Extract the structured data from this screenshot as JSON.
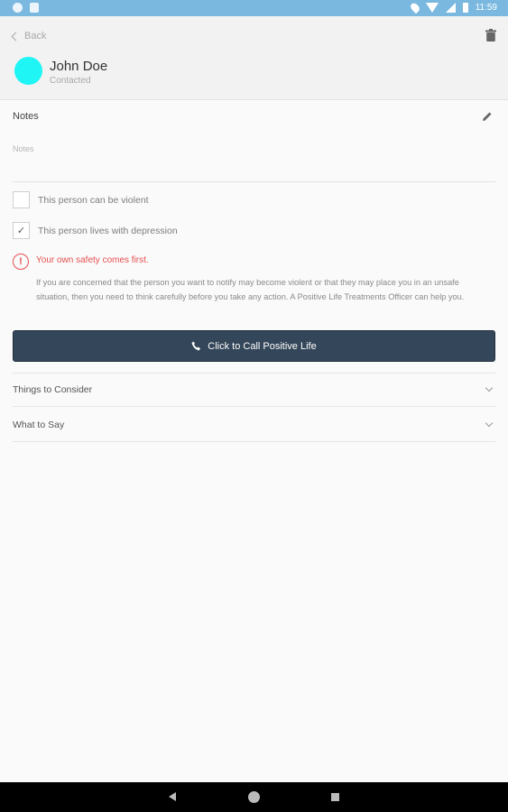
{
  "status_bar": {
    "time": "11:59"
  },
  "header": {
    "back_label": "Back",
    "contact_name": "John Doe",
    "contact_status": "Contacted",
    "avatar_color": "#1ff5f5"
  },
  "notes": {
    "title": "Notes",
    "placeholder": "Notes"
  },
  "checks": [
    {
      "label": "This person can be violent",
      "checked": false
    },
    {
      "label": "This person lives with depression",
      "checked": true
    }
  ],
  "warning": {
    "title": "Your own safety comes first.",
    "body": "If you are concerned that the person you want to notify may become violent or that they may place you in an unsafe situation, then you need to think carefully before you take any action. A Positive Life Treatments Officer can help you.",
    "color": "#e55050"
  },
  "call_button": {
    "label": "Click to Call Positive Life",
    "color": "#344659"
  },
  "accordions": [
    {
      "label": "Things to Consider"
    },
    {
      "label": "What to Say"
    }
  ],
  "icons": {
    "trash": "trash-icon",
    "edit": "pencil-icon",
    "phone": "phone-icon",
    "warning": "exclamation-circle-icon",
    "chevron": "chevron-down-icon"
  }
}
